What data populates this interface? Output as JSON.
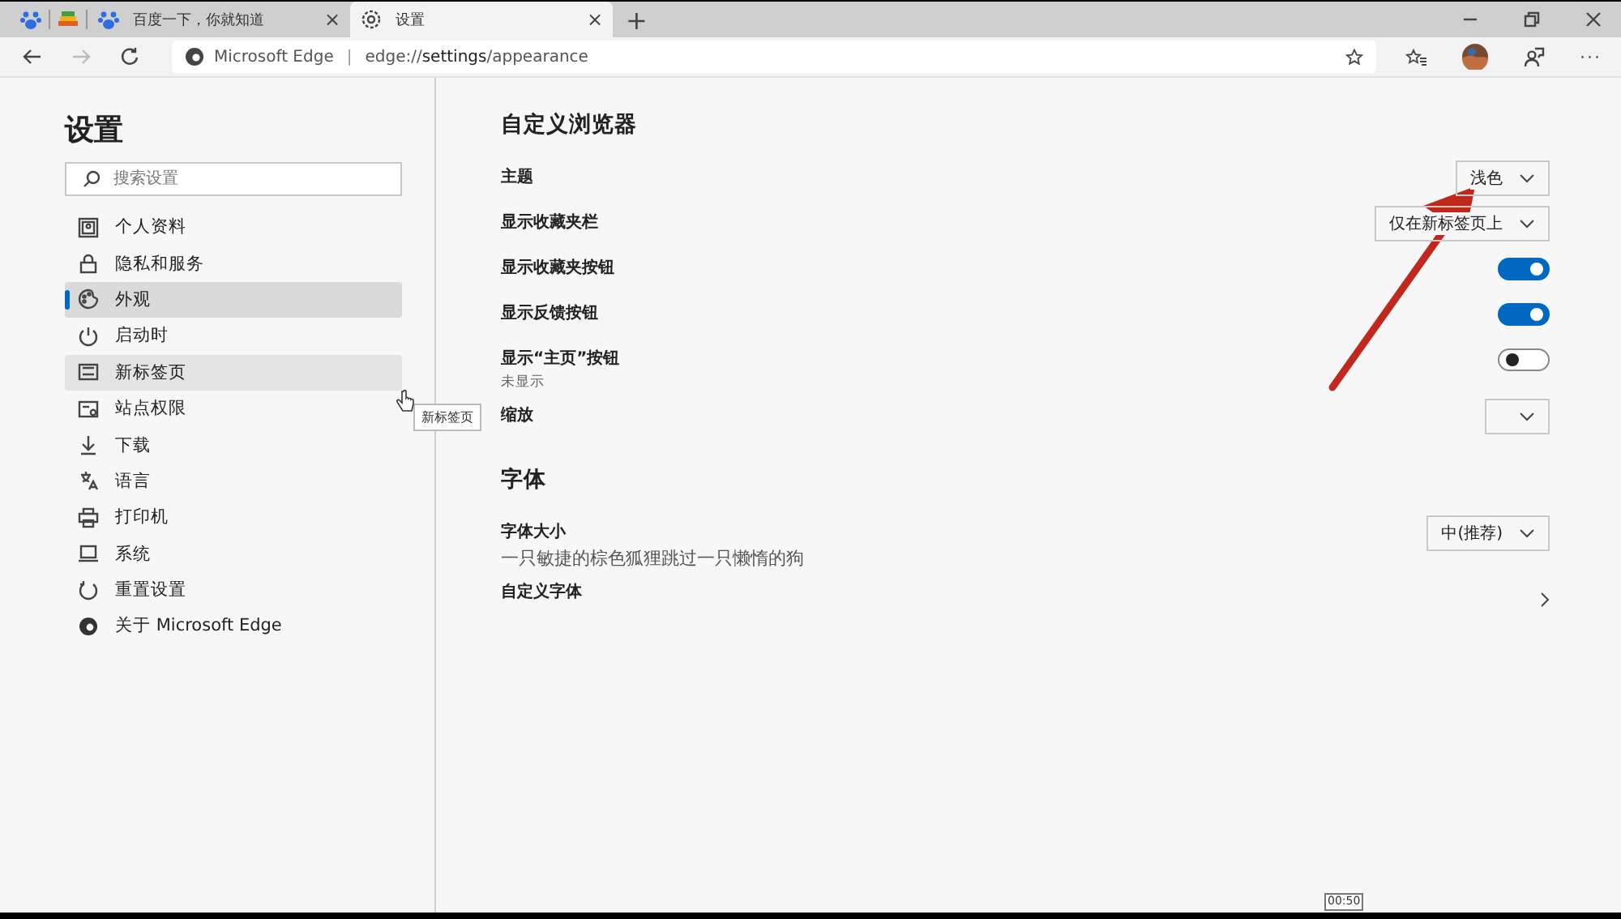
{
  "tabs": [
    {
      "kind": "pinned",
      "selected": false
    },
    {
      "kind": "pinned",
      "selected": false
    },
    {
      "kind": "page",
      "title": "百度一下，你就知道",
      "close": "×",
      "selected": false
    },
    {
      "kind": "page",
      "title": "设置",
      "close": "×",
      "selected": true
    }
  ],
  "new_tab": "+",
  "toolbar": {
    "forward_disabled": true,
    "site": "Microsoft Edge",
    "separator": "|",
    "url_scheme": "edge://",
    "url_host": "settings",
    "url_path": "/appearance",
    "more": "···"
  },
  "sidebar": {
    "title": "设置",
    "search": {
      "placeholder": "搜索设置"
    },
    "items": [
      {
        "label": "个人资料",
        "selected": false,
        "hovered": false
      },
      {
        "label": "隐私和服务",
        "selected": false,
        "hovered": false
      },
      {
        "label": "外观",
        "selected": true,
        "hovered": false
      },
      {
        "label": "启动时",
        "selected": false,
        "hovered": false
      },
      {
        "label": "新标签页",
        "selected": false,
        "hovered": true
      },
      {
        "label": "站点权限",
        "selected": false,
        "hovered": false
      },
      {
        "label": "下载",
        "selected": false,
        "hovered": false
      },
      {
        "label": "语言",
        "selected": false,
        "hovered": false
      },
      {
        "label": "打印机",
        "selected": false,
        "hovered": false
      },
      {
        "label": "系统",
        "selected": false,
        "hovered": false
      },
      {
        "label": "重置设置",
        "selected": false,
        "hovered": false
      },
      {
        "label": "关于 Microsoft Edge",
        "selected": false,
        "hovered": false
      }
    ]
  },
  "tooltip": "新标签页",
  "sections": [
    {
      "title": "自定义浏览器",
      "rows": [
        {
          "kind": "dropdown",
          "label": "主题",
          "value": "浅色"
        },
        {
          "kind": "dropdown",
          "label": "显示收藏夹栏",
          "value": "仅在新标签页上"
        },
        {
          "kind": "toggle",
          "label": "显示收藏夹按钮",
          "on": true
        },
        {
          "kind": "toggle",
          "label": "显示反馈按钮",
          "on": true
        },
        {
          "kind": "toggle",
          "label": "显示“主页”按钮",
          "sub": "未显示",
          "on": false
        },
        {
          "kind": "dropdown",
          "label": "缩放"
        }
      ]
    },
    {
      "title": "字体",
      "rows": [
        {
          "kind": "dropdown",
          "label": "字体大小",
          "sub": "一只敏捷的棕色狐狸跳过一只懒惰的狗",
          "value": "中(推荐)"
        },
        {
          "kind": "link",
          "label": "自定义字体"
        }
      ]
    }
  ],
  "timestamp": "00:50"
}
